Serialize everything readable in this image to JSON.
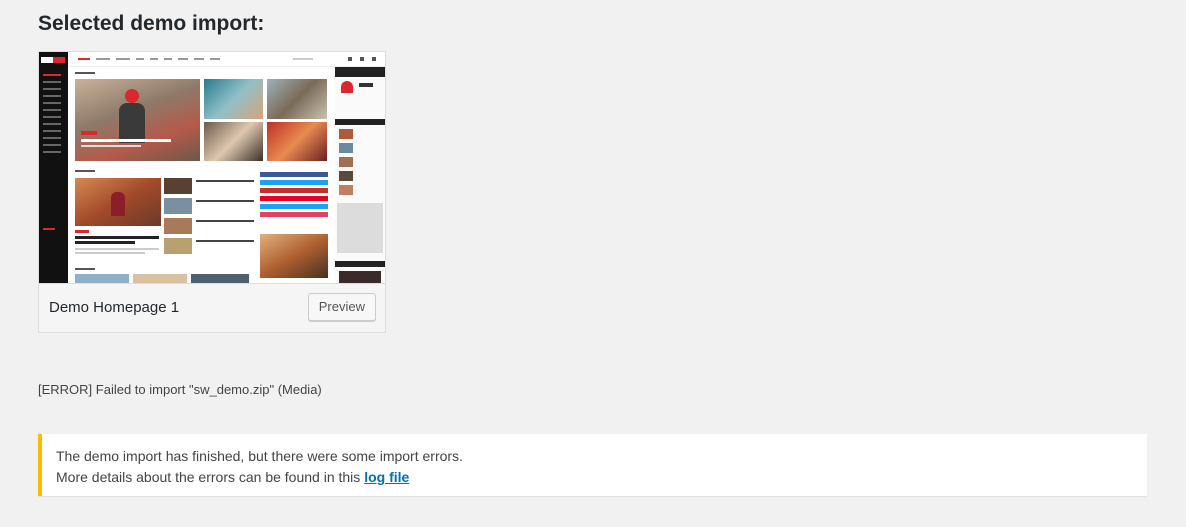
{
  "page": {
    "heading": "Selected demo import:"
  },
  "demo_card": {
    "title": "Demo Homepage 1",
    "preview_label": "Preview",
    "thumbnail_logo": "SITE NAME"
  },
  "import_log": {
    "error_text": "[ERROR] Failed to import \"sw_demo.zip\" (Media)"
  },
  "notice": {
    "line1": "The demo import has finished, but there were some import errors.",
    "line2_prefix": "More details about the errors can be found in this ",
    "link_label": "log file",
    "accent_color": "#ffb900"
  }
}
